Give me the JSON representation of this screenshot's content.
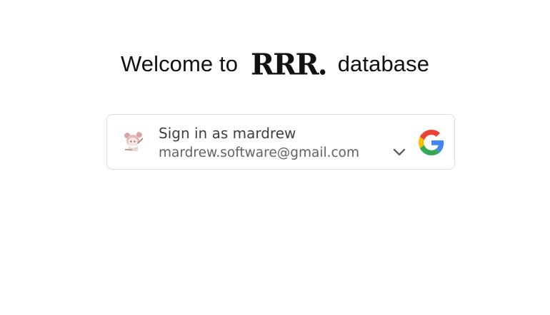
{
  "header": {
    "welcome_prefix": "Welcome to",
    "brand_logo": "RRR.",
    "welcome_suffix": "database"
  },
  "google_signin": {
    "title": "Sign in as mardrew",
    "email": "mardrew.software@gmail.com",
    "avatar_icon": "user-avatar-icon",
    "chevron_icon": "chevron-down-icon",
    "provider_icon": "google-logo-icon",
    "border_color": "#dadce0"
  },
  "colors": {
    "google_blue": "#4285F4",
    "google_red": "#EA4335",
    "google_yellow": "#FBBC05",
    "google_green": "#34A853"
  }
}
